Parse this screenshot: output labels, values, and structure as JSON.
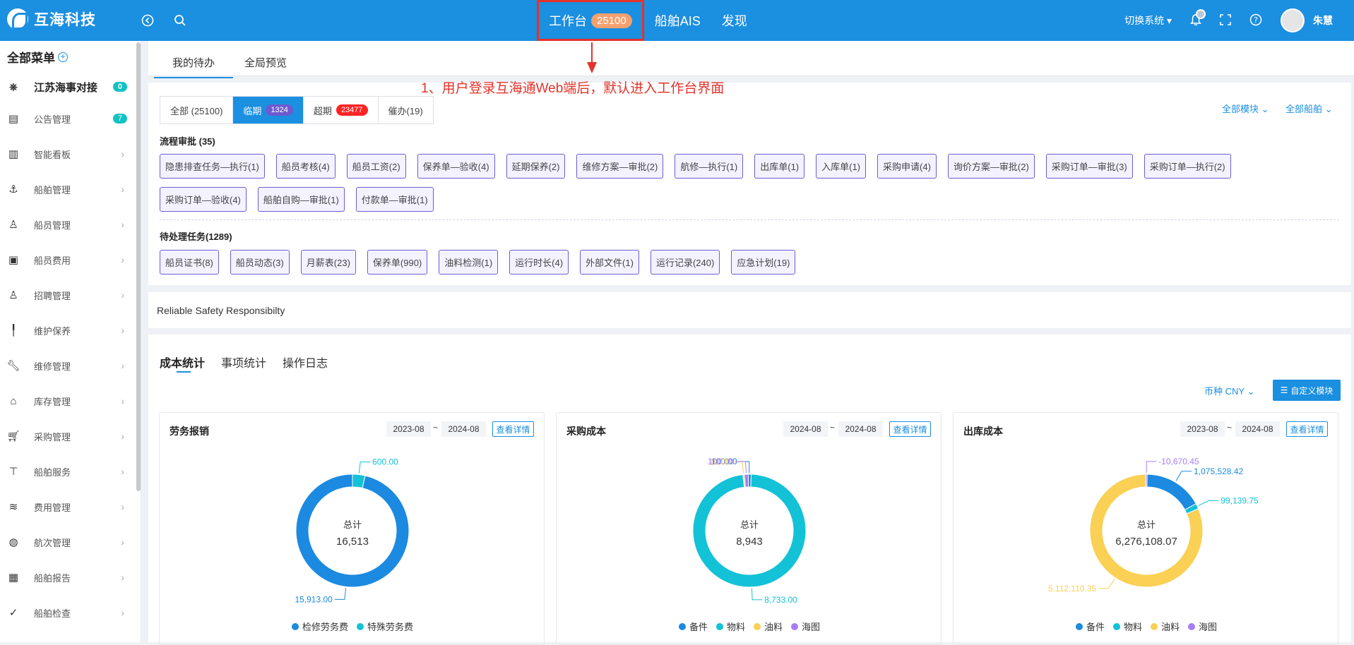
{
  "header": {
    "logo_text": "互海科技",
    "nav": [
      {
        "label": "工作台",
        "badge": "25100"
      },
      {
        "label": "船舶AIS"
      },
      {
        "label": "发现"
      }
    ],
    "switch_system": "切换系统",
    "user_name": "朱慧"
  },
  "sidebar": {
    "title": "全部菜单",
    "org": {
      "label": "江苏海事对接",
      "count": "0"
    },
    "items": [
      {
        "label": "公告管理",
        "icon": "book-icon",
        "count": "7"
      },
      {
        "label": "智能看板",
        "icon": "bar-chart-icon"
      },
      {
        "label": "船舶管理",
        "icon": "anchor-icon"
      },
      {
        "label": "船员管理",
        "icon": "user-icon"
      },
      {
        "label": "船员费用",
        "icon": "wallet-icon"
      },
      {
        "label": "招聘管理",
        "icon": "user-icon"
      },
      {
        "label": "维护保养",
        "icon": "brush-icon"
      },
      {
        "label": "维修管理",
        "icon": "wrench-icon"
      },
      {
        "label": "库存管理",
        "icon": "home-icon"
      },
      {
        "label": "采购管理",
        "icon": "cart-icon"
      },
      {
        "label": "船舶服务",
        "icon": "paint-roller-icon"
      },
      {
        "label": "费用管理",
        "icon": "database-icon"
      },
      {
        "label": "航次管理",
        "icon": "globe-icon"
      },
      {
        "label": "船舶报告",
        "icon": "calendar-icon"
      },
      {
        "label": "船舶检查",
        "icon": "check-circle-icon"
      }
    ]
  },
  "top_tabs": [
    "我的待办",
    "全局预览"
  ],
  "annotation": "1、用户登录互海通Web端后，默认进入工作台界面",
  "filter_tabs": {
    "all": "全部 (25100)",
    "near": "临期",
    "near_count": "1324",
    "overdue": "超期",
    "overdue_count": "23477",
    "urge": "催办(19)",
    "all_modules": "全部模块",
    "all_ships": "全部船舶"
  },
  "approval": {
    "title": "流程审批 (35)",
    "chips": [
      "隐患排查任务—执行(1)",
      "船员考核(4)",
      "船员工资(2)",
      "保养单—验收(4)",
      "延期保养(2)",
      "维修方案—审批(2)",
      "航修—执行(1)",
      "出库单(1)",
      "入库单(1)",
      "采购申请(4)",
      "询价方案—审批(2)",
      "采购订单—审批(3)",
      "采购订单—执行(2)",
      "采购订单—验收(4)",
      "船舶自购—审批(1)",
      "付款单—审批(1)"
    ]
  },
  "tasks": {
    "title": "待处理任务(1289)",
    "chips": [
      "船员证书(8)",
      "船员动态(3)",
      "月薪表(23)",
      "保养单(990)",
      "油料检测(1)",
      "运行时长(4)",
      "外部文件(1)",
      "运行记录(240)",
      "应急计划(19)"
    ]
  },
  "slogan": "Reliable Safety Responsibilty",
  "stats_tabs": [
    "成本统计",
    "事项统计",
    "操作日志"
  ],
  "currency": "币种 CNY",
  "custom_module": "自定义模块",
  "cards": [
    {
      "title": "劳务报销",
      "from": "2023-08",
      "to": "2024-08",
      "detail": "查看详情",
      "total_label": "总计",
      "total": "16,513",
      "slices": [
        {
          "name": "检修劳务费",
          "value": 15913.0,
          "label": "15,913.00",
          "color": "#1b8ae0"
        },
        {
          "name": "特殊劳务费",
          "value": 600.0,
          "label": "600.00",
          "color": "#13c2d6"
        }
      ]
    },
    {
      "title": "采购成本",
      "from": "2024-08",
      "to": "2024-08",
      "detail": "查看详情",
      "total_label": "总计",
      "total": "8,943",
      "slices": [
        {
          "name": "备件",
          "value": 100.0,
          "label": "100.00",
          "color": "#1b8ae0"
        },
        {
          "name": "物料",
          "value": 8733.0,
          "label": "8,733.00",
          "color": "#13c2d6"
        },
        {
          "name": "油料",
          "value": 10.0,
          "label": "10.00",
          "color": "#fad055"
        },
        {
          "name": "海图",
          "value": 100.0,
          "label": "100.00",
          "color": "#a77ef7"
        }
      ]
    },
    {
      "title": "出库成本",
      "from": "2023-08",
      "to": "2024-08",
      "detail": "查看详情",
      "total_label": "总计",
      "total": "6,276,108.07",
      "slices": [
        {
          "name": "备件",
          "value": 1075528.42,
          "label": "1,075,528.42",
          "color": "#1b8ae0"
        },
        {
          "name": "物料",
          "value": 99139.75,
          "label": "99,139.75",
          "color": "#13c2d6"
        },
        {
          "name": "油料",
          "value": 5112110.35,
          "label": "5,112,110.35",
          "color": "#fad055"
        },
        {
          "name": "海图",
          "value": -10670.45,
          "label": "-10,670.45",
          "color": "#a77ef7"
        }
      ]
    }
  ]
}
